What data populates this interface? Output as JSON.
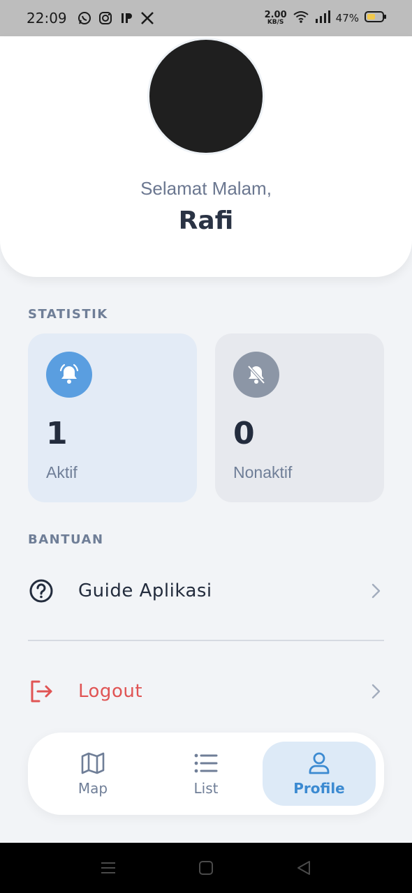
{
  "status_bar": {
    "time": "22:09",
    "net_speed_value": "2.00",
    "net_speed_unit": "KB/S",
    "battery": "47%",
    "left_icons": [
      "whatsapp-icon",
      "instagram-icon",
      "ip-icon",
      "x-icon"
    ],
    "right_icons": [
      "wifi-icon",
      "signal-icon",
      "battery-icon"
    ]
  },
  "header": {
    "greeting": "Selamat Malam,",
    "name": "Rafi"
  },
  "statistics": {
    "label": "STATISTIK",
    "cards": [
      {
        "value": "1",
        "label": "Aktif",
        "icon": "bell-active-icon",
        "color": "#5a9ee0"
      },
      {
        "value": "0",
        "label": "Nonaktif",
        "icon": "bell-off-icon",
        "color": "#8c96a6"
      }
    ]
  },
  "help": {
    "label": "BANTUAN",
    "guide_label": "Guide Aplikasi",
    "logout_label": "Logout"
  },
  "bottom_nav": {
    "items": [
      {
        "label": "Map",
        "icon": "map-icon"
      },
      {
        "label": "List",
        "icon": "list-icon"
      },
      {
        "label": "Profile",
        "icon": "profile-icon",
        "active": true
      }
    ]
  },
  "colors": {
    "accent": "#3b8ad1",
    "danger": "#e05454",
    "text_primary": "#232c3d",
    "text_muted": "#6f7e97"
  }
}
